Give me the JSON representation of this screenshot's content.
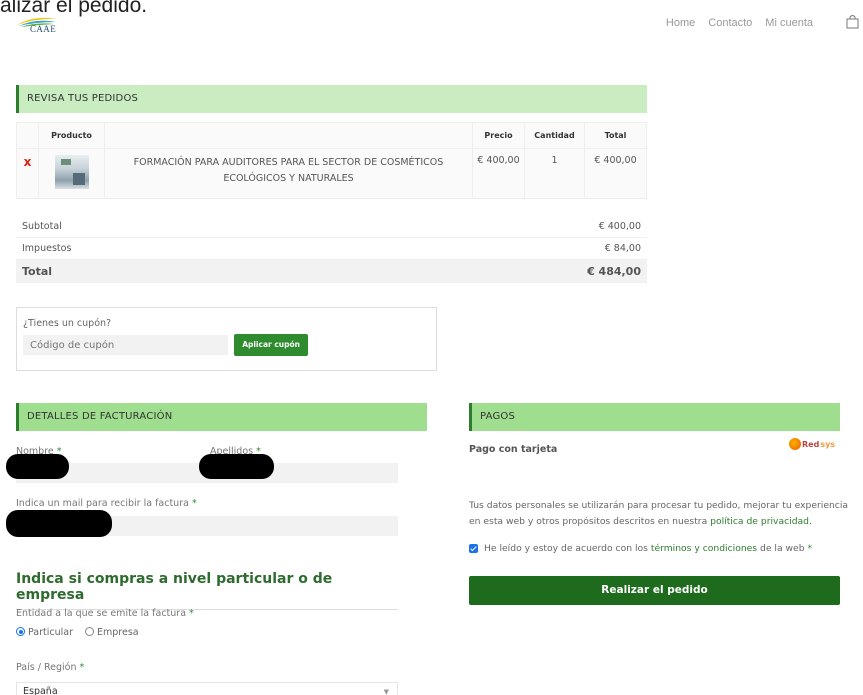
{
  "top_cut_text": "alizar el pedido.",
  "brand": {
    "logo_text": "CAAE"
  },
  "nav": {
    "items": [
      "Home",
      "Contacto",
      "Mi cuenta"
    ]
  },
  "review": {
    "header": "REVISA TUS PEDIDOS",
    "columns": {
      "product": "Producto",
      "price": "Precio",
      "qty": "Cantidad",
      "total": "Total"
    },
    "rows": [
      {
        "remove": "x",
        "name": "FORMACIÓN PARA AUDITORES PARA EL SECTOR DE COSMÉTICOS ECOLÓGICOS Y NATURALES",
        "price": "€ 400,00",
        "qty": "1",
        "total": "€ 400,00"
      }
    ]
  },
  "totals": {
    "subtotal_label": "Subtotal",
    "subtotal": "€ 400,00",
    "tax_label": "Impuestos",
    "tax": "€ 84,00",
    "total_label": "Total",
    "total": "€ 484,00"
  },
  "coupon": {
    "question": "¿Tienes un cupón?",
    "placeholder": "Código de cupón",
    "button": "Aplicar cupón"
  },
  "billing": {
    "header": "DETALLES DE FACTURACIÓN",
    "first_name_label": "Nombre",
    "last_name_label": "Apellidos",
    "email_label": "Indica un mail para recibir la factura",
    "required_mark": "*",
    "heading": "Indica si compras a nivel particular o de empresa",
    "entity_label": "Entidad a la que se emite la factura",
    "entity_options": [
      "Particular",
      "Empresa"
    ],
    "entity_selected": "Particular",
    "country_label": "País / Región",
    "country_value": "España"
  },
  "payments": {
    "header": "PAGOS",
    "method": "Pago con tarjeta",
    "logo": {
      "a": "Red",
      "b": "sys"
    },
    "privacy_text_a": "Tus datos personales se utilizarán para procesar tu pedido, mejorar tu experiencia en esta web y otros propósitos descritos en nuestra ",
    "privacy_link": "política de privacidad",
    "privacy_text_b": ".",
    "terms_a": "He leído y estoy de acuerdo con los ",
    "terms_link": "términos y condiciones",
    "terms_b": " de la web",
    "order_button": "Realizar el pedido"
  },
  "colors": {
    "accent": "#2e8b2e",
    "header_bg": "#c9ecc1",
    "order_button": "#1e6b1e"
  }
}
